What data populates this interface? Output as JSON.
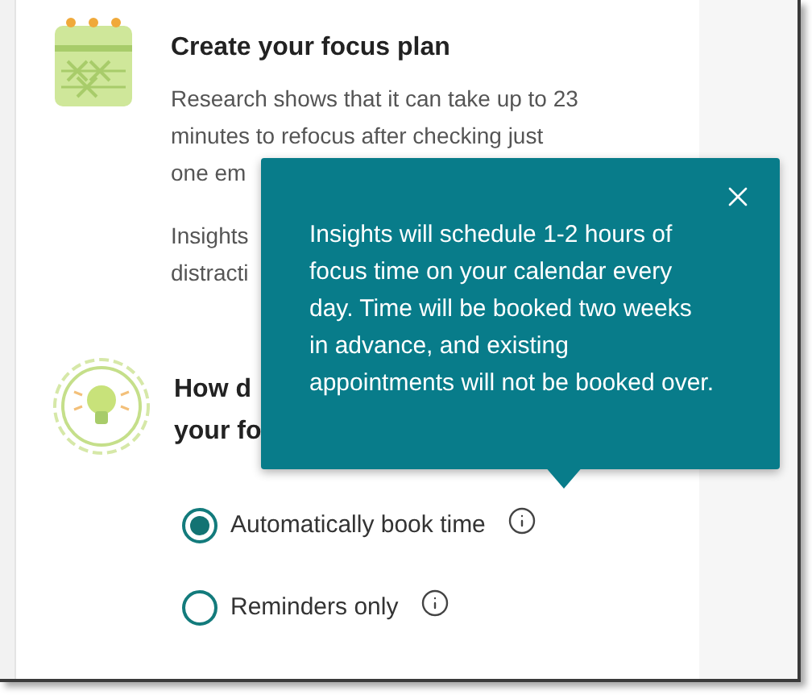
{
  "plan": {
    "title": "Create your focus plan",
    "body_lines": [
      "Research shows that it can take up to 23",
      "minutes to refocus after checking just",
      "one em"
    ],
    "insight_lines": [
      "Insights",
      "distracti"
    ]
  },
  "question": {
    "lines": [
      "How d",
      "your fo"
    ]
  },
  "options": [
    {
      "label": "Automatically book time",
      "selected": true
    },
    {
      "label": "Reminders only",
      "selected": false
    }
  ],
  "tooltip": {
    "text": "Insights will schedule 1-2 hours of focus time on your calendar every day. Time will be booked two weeks in advance, and existing appointments will not be booked over."
  }
}
